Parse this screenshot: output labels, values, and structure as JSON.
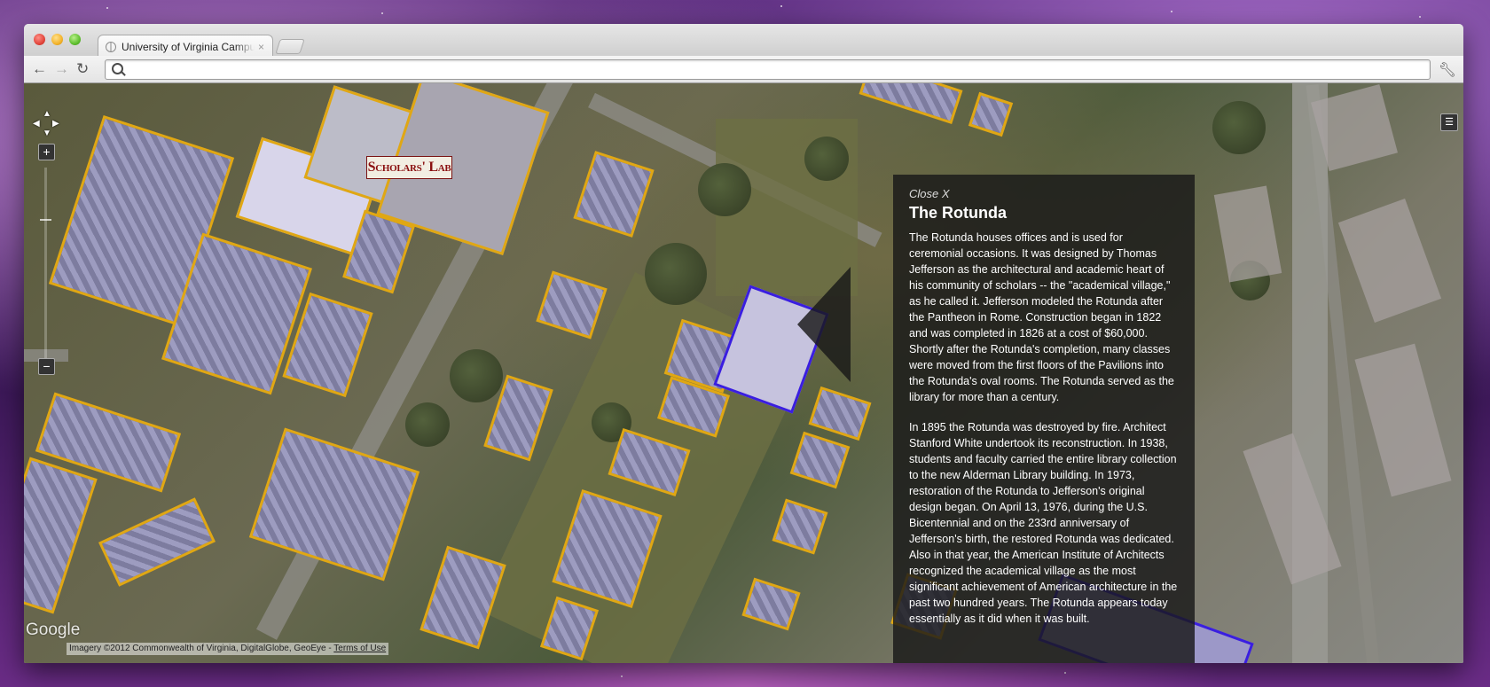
{
  "browser": {
    "tab_title": "University of Virginia Campus",
    "tab_close": "×",
    "address_value": "",
    "address_placeholder": ""
  },
  "map": {
    "sign_text": "Scholars' Lab",
    "google_logo": "Google",
    "attribution": "Imagery ©2012 Commonwealth of Virginia, DigitalGlobe, GeoEye - ",
    "terms": "Terms of Use",
    "zoom_in": "+",
    "zoom_out": "−",
    "highlight_color": "#e0a714",
    "selected_color": "#3a1ee0"
  },
  "info_panel": {
    "close_label": "Close X",
    "title": "The Rotunda",
    "paragraph1": "The Rotunda houses offices and is used for ceremonial occasions. It was designed by Thomas Jefferson as the architectural and academic heart of his community of scholars -- the \"academical village,\" as he called it. Jefferson modeled the Rotunda after the Pantheon in Rome. Construction began in 1822 and was completed in 1826 at a cost of $60,000. Shortly after the Rotunda's completion, many classes were moved from the first floors of the Pavilions into the Rotunda's oval rooms. The Rotunda served as the library for more than a century.",
    "paragraph2": "In 1895 the Rotunda was destroyed by fire. Architect Stanford White undertook its reconstruction. In 1938, students and faculty carried the entire library collection to the new Alderman Library building. In 1973, restoration of the Rotunda to Jefferson's original design began. On April 13, 1976, during the U.S. Bicentennial and on the 233rd anniversary of Jefferson's birth, the restored Rotunda was dedicated. Also in that year, the American Institute of Architects recognized the academical village as the most significant achievement of American architecture in the past two hundred years. The Rotunda appears today essentially as it did when it was built."
  }
}
